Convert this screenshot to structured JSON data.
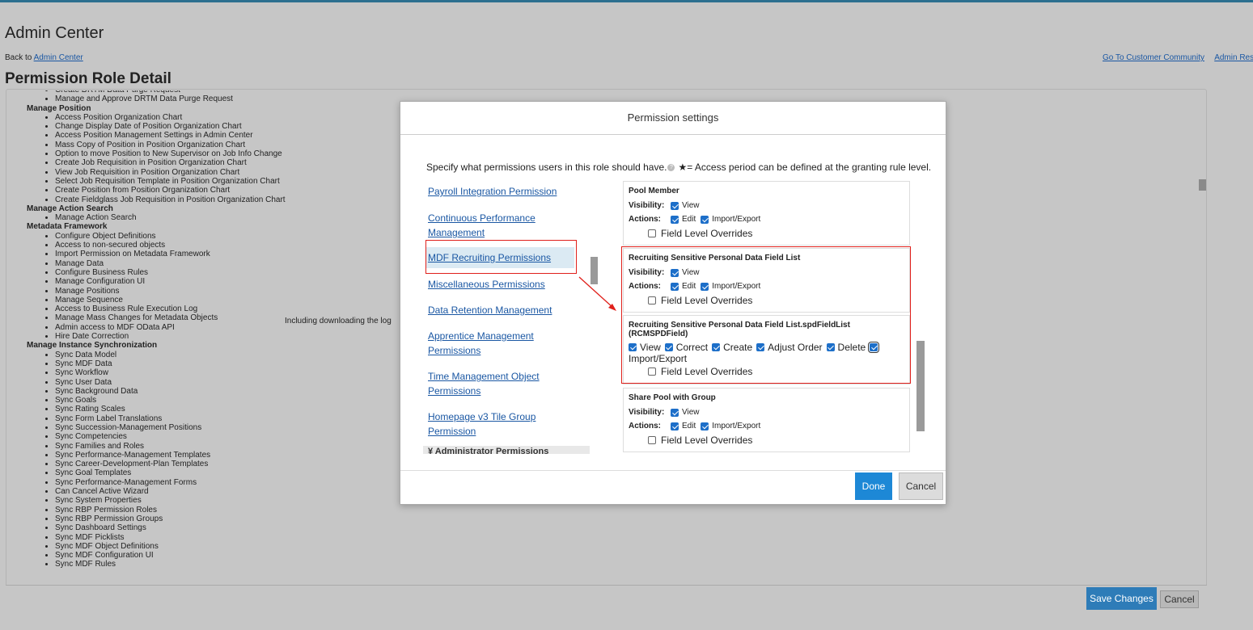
{
  "page": {
    "title": "Admin Center",
    "back_prefix": "Back to",
    "back_link": "Admin Center",
    "top_links": [
      "Go To Customer Community",
      "Admin Resc"
    ],
    "role_title": "Permission Role Detail"
  },
  "permission_list": [
    {
      "group": "",
      "items": [
        "Create DRTM Data Purge Request",
        "Manage and Approve DRTM Data Purge Request"
      ]
    },
    {
      "group": "Manage Position",
      "items": [
        "Access Position Organization Chart",
        "Change Display Date of Position Organization Chart",
        "Access Position Management Settings in Admin Center",
        "Mass Copy of Position in Position Organization Chart",
        "Option to move Position to New Supervisor on Job Info Change",
        "Create Job Requisition in Position Organization Chart",
        "View Job Requisition in Position Organization Chart",
        "Select Job Requisition Template in Position Organization Chart",
        "Create Position from Position Organization Chart",
        "Create Fieldglass Job Requisition in Position Organization Chart"
      ]
    },
    {
      "group": "Manage Action Search",
      "items": [
        "Manage Action Search"
      ]
    },
    {
      "group": "Metadata Framework",
      "items": [
        "Configure Object Definitions",
        "Access to non-secured objects",
        "Import Permission on Metadata Framework",
        "Manage Data",
        "Configure Business Rules",
        "Manage Configuration UI",
        "Manage Positions",
        "Manage Sequence",
        "Access to Business Rule Execution Log",
        "Manage Mass Changes for Metadata Objects",
        "Admin access to MDF OData API",
        "Hire Date Correction"
      ]
    },
    {
      "group": "Manage Instance Synchronization",
      "items": [
        "Sync Data Model",
        "Sync MDF Data",
        "Sync Workflow",
        "Sync User Data",
        "Sync Background Data",
        "Sync Goals",
        "Sync Rating Scales",
        "Sync Form Label Translations",
        "Sync Succession-Management Positions",
        "Sync Competencies",
        "Sync Families and Roles",
        "Sync Performance-Management Templates",
        "Sync Career-Development-Plan Templates",
        "Sync Goal Templates",
        "Sync Performance-Management Forms",
        "Can Cancel Active Wizard",
        "Sync System Properties",
        "Sync RBP Permission Roles",
        "Sync RBP Permission Groups",
        "Sync Dashboard Settings",
        "Sync MDF Picklists",
        "Sync MDF Object Definitions",
        "Sync MDF Configuration UI",
        "Sync MDF Rules"
      ]
    }
  ],
  "log_note": "Including downloading the log",
  "footer": {
    "save": "Save Changes",
    "cancel": "Cancel"
  },
  "modal": {
    "title": "Permission settings",
    "instruction": "Specify what permissions users in this role should have.",
    "access_note": "★= Access period can be defined at the granting rule level.",
    "help_glyph": "?",
    "nav": [
      "Payroll Integration Permission",
      "Continuous Performance Management",
      "MDF Recruiting Permissions",
      "Miscellaneous Permissions",
      "Data Retention Management",
      "Apprentice Management Permissions",
      "Time Management Object Permissions",
      "Homepage v3 Tile Group Permission"
    ],
    "nav_selected": "MDF Recruiting Permissions",
    "nav_section": "Administrator Permissions",
    "labels": {
      "visibility": "Visibility:",
      "actions": "Actions:"
    },
    "sections": [
      {
        "title": "Pool Member",
        "visibility": "View",
        "actions": [
          "Edit",
          "Import/Export"
        ],
        "field_overrides": "Field Level Overrides"
      },
      {
        "title": "Recruiting Sensitive Personal Data Field List",
        "visibility": "View",
        "actions": [
          "Edit",
          "Import/Export"
        ],
        "field_overrides": "Field Level Overrides"
      },
      {
        "title": "Recruiting Sensitive Personal Data Field List.spdFieldList (RCMSPDField)",
        "options": [
          "View",
          "Correct",
          "Create",
          "Adjust Order",
          "Delete",
          "Import/Export"
        ],
        "field_overrides": "Field Level Overrides"
      },
      {
        "title": "Share Pool with Group",
        "visibility": "View",
        "actions": [
          "Edit",
          "Import/Export"
        ],
        "field_overrides": "Field Level Overrides"
      }
    ],
    "done": "Done",
    "cancel": "Cancel"
  },
  "colors": {
    "accent": "#1d88d6",
    "highlight": "#e0201b",
    "link": "#1a57a3"
  }
}
